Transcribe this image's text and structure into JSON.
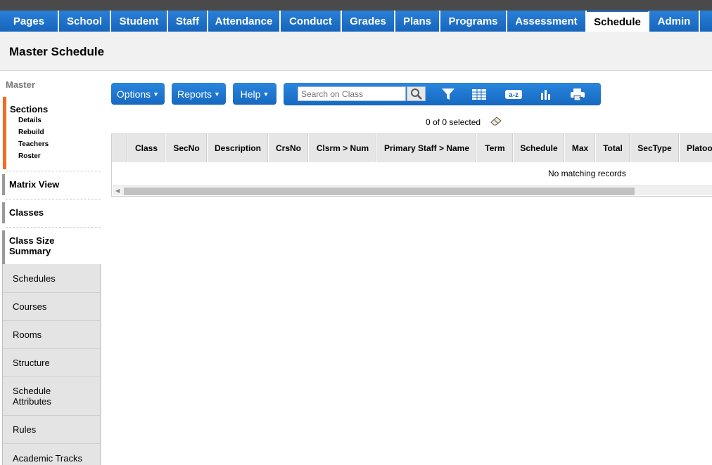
{
  "tabs": [
    {
      "label": "Pages",
      "active": false
    },
    {
      "label": "School",
      "active": false
    },
    {
      "label": "Student",
      "active": false
    },
    {
      "label": "Staff",
      "active": false
    },
    {
      "label": "Attendance",
      "active": false
    },
    {
      "label": "Conduct",
      "active": false
    },
    {
      "label": "Grades",
      "active": false
    },
    {
      "label": "Plans",
      "active": false
    },
    {
      "label": "Programs",
      "active": false
    },
    {
      "label": "Assessment",
      "active": false
    },
    {
      "label": "Schedule",
      "active": true
    },
    {
      "label": "Admin",
      "active": false
    }
  ],
  "page": {
    "title": "Master Schedule"
  },
  "sidebar": {
    "section_label": "Master",
    "active": {
      "title": "Sections",
      "subitems": [
        "Details",
        "Rebuild",
        "Teachers",
        "Roster"
      ]
    },
    "views": [
      "Matrix View",
      "Classes",
      "Class Size Summary"
    ],
    "nav": [
      "Schedules",
      "Courses",
      "Rooms",
      "Structure",
      "Schedule Attributes",
      "Rules",
      "Academic Tracks"
    ]
  },
  "toolbar": {
    "options_label": "Options",
    "reports_label": "Reports",
    "help_label": "Help",
    "search_placeholder": "Search on Class",
    "icons": [
      "search-icon",
      "filter-icon",
      "grid-icon",
      "sort-az-icon",
      "chart-icon",
      "print-icon"
    ]
  },
  "selection": {
    "text": "0 of 0 selected"
  },
  "table": {
    "columns": [
      "Class",
      "SecNo",
      "Description",
      "CrsNo",
      "Clsrm > Num",
      "Primary Staff > Name",
      "Term",
      "Schedule",
      "Max",
      "Total",
      "SecType",
      "Platoon"
    ],
    "empty_message": "No matching records"
  },
  "colors": {
    "tab_blue": "#1f6fc5",
    "accent_orange": "#f26c21",
    "header_bg": "#f1f1f1"
  }
}
